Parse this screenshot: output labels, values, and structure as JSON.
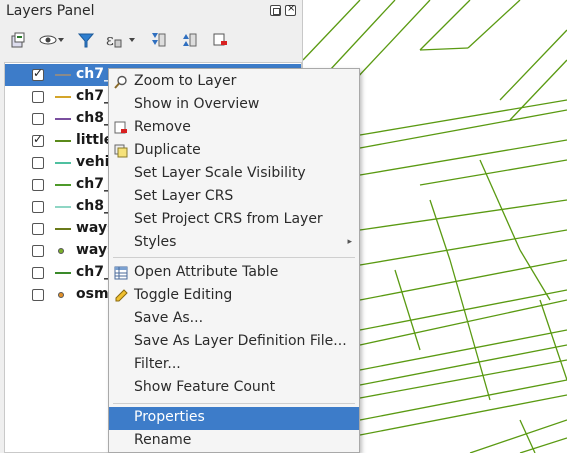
{
  "panel": {
    "title": "Layers Panel",
    "title_buttons": [
      "float-icon",
      "close-icon"
    ],
    "toolbar": [
      "add-group-icon",
      "visibility-eye-icon",
      "filter-icon",
      "expression-filter-icon",
      "expand-all-icon",
      "collapse-all-icon",
      "remove-layer-icon"
    ]
  },
  "layers": [
    {
      "label": "ch7_",
      "checked": true,
      "symbol": "line",
      "color": "#8a8a8a",
      "selected": true
    },
    {
      "label": "ch7_",
      "checked": false,
      "symbol": "line",
      "color": "#d4a52a",
      "selected": false
    },
    {
      "label": "ch8_",
      "checked": false,
      "symbol": "line",
      "color": "#7a4f9f",
      "selected": false
    },
    {
      "label": "little",
      "checked": true,
      "symbol": "line",
      "color": "#5a8a1a",
      "selected": false
    },
    {
      "label": "vehic",
      "checked": false,
      "symbol": "line",
      "color": "#4fc0a0",
      "selected": false
    },
    {
      "label": "ch7_",
      "checked": false,
      "symbol": "line",
      "color": "#4e9a2a",
      "selected": false
    },
    {
      "label": "ch8_",
      "checked": false,
      "symbol": "line",
      "color": "#8fd6c4",
      "selected": false
    },
    {
      "label": "ways",
      "checked": false,
      "symbol": "line",
      "color": "#6a7a1a",
      "selected": false
    },
    {
      "label": "ways",
      "checked": false,
      "symbol": "point",
      "color": "#7ab02a",
      "selected": false
    },
    {
      "label": "ch7_",
      "checked": false,
      "symbol": "line",
      "color": "#3a8a2a",
      "selected": false
    },
    {
      "label": "osm_",
      "checked": false,
      "symbol": "point",
      "color": "#e0902a",
      "selected": false
    }
  ],
  "menu": {
    "items": [
      {
        "label": "Zoom to Layer",
        "icon": "zoom-icon"
      },
      {
        "label": "Show in Overview",
        "icon": ""
      },
      {
        "label": "Remove",
        "icon": "remove-icon"
      },
      {
        "label": "Duplicate",
        "icon": "duplicate-icon"
      },
      {
        "label": "Set Layer Scale Visibility",
        "icon": ""
      },
      {
        "label": "Set Layer CRS",
        "icon": ""
      },
      {
        "label": "Set Project CRS from Layer",
        "icon": ""
      },
      {
        "label": "Styles",
        "icon": "",
        "submenu": true
      },
      {
        "label": "Open Attribute Table",
        "icon": "table-icon"
      },
      {
        "label": "Toggle Editing",
        "icon": "pencil-icon"
      },
      {
        "label": "Save As...",
        "icon": ""
      },
      {
        "label": "Save As Layer Definition File...",
        "icon": ""
      },
      {
        "label": "Filter...",
        "icon": ""
      },
      {
        "label": "Show Feature Count",
        "icon": ""
      },
      {
        "label": "Properties",
        "icon": "",
        "highlighted": true
      },
      {
        "label": "Rename",
        "icon": ""
      }
    ]
  },
  "colors": {
    "selection": "#3d7cc9",
    "map_lines": "#5a9a12"
  }
}
